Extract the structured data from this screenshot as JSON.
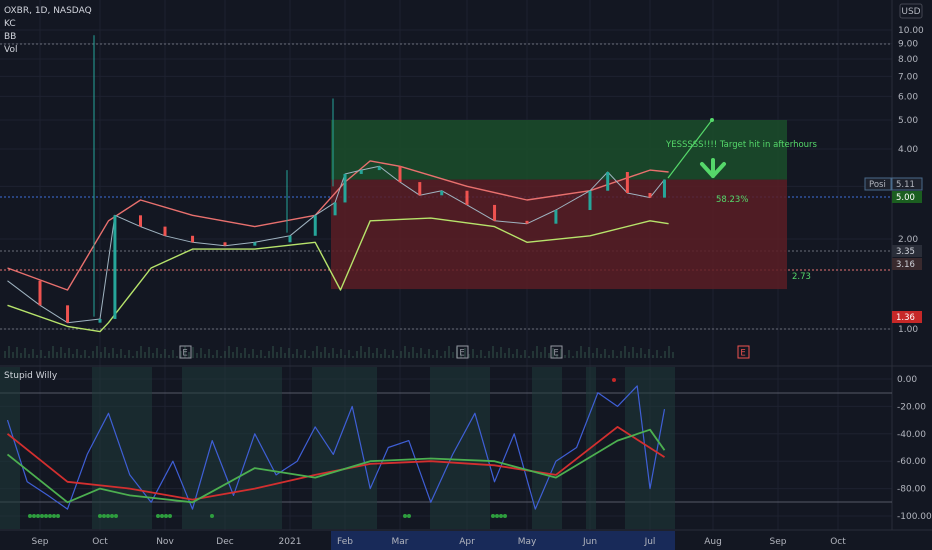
{
  "header": {
    "symbol_line": "OXBR, 1D, NASDAQ",
    "studies": [
      "KC",
      "BB",
      "Vol"
    ],
    "currency": "USD"
  },
  "colors": {
    "background": "#131722",
    "grid": "#1e2230",
    "up": "#26a69a",
    "down": "#ef5350",
    "profit_zone": "#1b4d2a",
    "loss_zone": "#5a1d24",
    "kc_upper": "#e8706e",
    "kc_lower": "#b7e36b",
    "osc_fast": "#3f5fd6",
    "osc_green": "#4caf50",
    "osc_red": "#d32f2f",
    "annotation": "#55d86a"
  },
  "chart_data": [
    {
      "type": "line",
      "title": "OXBR, 1D, NASDAQ",
      "subtitle": "",
      "ylabel": "",
      "xlabel": "",
      "ylim": [
        0.6,
        10.5
      ],
      "y_scale": "log",
      "grid": true,
      "x_ticks": [
        "Sep",
        "Oct",
        "Nov",
        "Dec",
        "2021",
        "Feb",
        "Mar",
        "Apr",
        "May",
        "Jun",
        "Jul",
        "Aug",
        "Sep",
        "Oct"
      ],
      "y_ticks": [
        "10.00",
        "9.00",
        "8.00",
        "7.00",
        "6.00",
        "5.00",
        "4.00",
        "3.00",
        "2.00",
        "1.00"
      ],
      "series": [
        {
          "role": "close",
          "x": [
            "Aug 15",
            "Sep 1",
            "Sep 15",
            "Oct 1",
            "Oct 8",
            "Oct 20",
            "Nov 1",
            "Nov 15",
            "Dec 1",
            "Dec 15",
            "Jan 1",
            "Jan 15",
            "Jan 26",
            "Feb 1",
            "Feb 10",
            "Feb 20",
            "Mar 1",
            "Mar 10",
            "Mar 20",
            "Apr 1",
            "Apr 15",
            "May 1",
            "May 15",
            "Jun 1",
            "Jun 10",
            "Jun 20",
            "Jul 1",
            "Jul 8"
          ],
          "values": [
            1.45,
            1.2,
            1.05,
            1.08,
            2.4,
            2.2,
            2.05,
            1.95,
            1.9,
            1.95,
            2.05,
            2.4,
            2.65,
            3.3,
            3.4,
            3.5,
            3.1,
            2.8,
            2.9,
            2.6,
            2.3,
            2.25,
            2.5,
            2.9,
            3.35,
            2.85,
            2.75,
            3.16
          ]
        },
        {
          "role": "kc_upper",
          "x": [
            "Aug 15",
            "Sep 15",
            "Oct 5",
            "Oct 20",
            "Nov 15",
            "Dec 15",
            "Jan 15",
            "Feb 1",
            "Feb 15",
            "Mar 1",
            "Apr 1",
            "May 1",
            "Jun 1",
            "Jul 1",
            "Jul 10"
          ],
          "values": [
            1.6,
            1.35,
            2.3,
            2.7,
            2.4,
            2.2,
            2.4,
            3.1,
            3.65,
            3.5,
            3.0,
            2.7,
            2.9,
            3.4,
            3.35
          ]
        },
        {
          "role": "kc_lower",
          "x": [
            "Aug 15",
            "Sep 15",
            "Oct 1",
            "Oct 5",
            "Oct 25",
            "Nov 15",
            "Dec 15",
            "Jan 15",
            "Jan 29",
            "Feb 15",
            "Mar 15",
            "Apr 15",
            "May 1",
            "Jun 1",
            "Jul 1",
            "Jul 10"
          ],
          "values": [
            1.2,
            1.02,
            0.98,
            1.05,
            1.6,
            1.85,
            1.85,
            1.95,
            1.35,
            2.3,
            2.35,
            2.2,
            1.95,
            2.05,
            2.3,
            2.25
          ]
        }
      ],
      "position": {
        "label": "Posi",
        "value": "5.11",
        "target_price": "5.00",
        "entry_price": "3.16",
        "stop_price": "1.36",
        "gain_label": "58.23%",
        "ratio_label": "2.73",
        "last_price": "3.35",
        "price_labels": [
          "5.11",
          "5.00",
          "3.35",
          "3.16",
          "1.36"
        ]
      },
      "earnings_markers": [
        "E",
        "E",
        "E",
        "E"
      ],
      "annotations": [
        "YESSSSS!!!! Target hit in afterhours"
      ]
    },
    {
      "type": "line",
      "title": "Stupid Willy",
      "subtitle": "",
      "xlabel": "",
      "ylabel": "",
      "ylim": [
        -105,
        5
      ],
      "grid": true,
      "y_ticks": [
        "0.00",
        "-20.00",
        "-40.00",
        "-60.00",
        "-80.00",
        "-100.00"
      ],
      "series": [
        {
          "role": "fast",
          "x": [
            "Aug 15",
            "Aug 25",
            "Sep 5",
            "Sep 15",
            "Sep 25",
            "Oct 5",
            "Oct 15",
            "Oct 25",
            "Nov 5",
            "Nov 15",
            "Nov 25",
            "Dec 5",
            "Dec 15",
            "Dec 25",
            "Jan 5",
            "Jan 15",
            "Jan 25",
            "Feb 5",
            "Feb 15",
            "Feb 25",
            "Mar 5",
            "Mar 15",
            "Mar 25",
            "Apr 5",
            "Apr 15",
            "Apr 25",
            "May 5",
            "May 15",
            "May 25",
            "Jun 5",
            "Jun 15",
            "Jun 25",
            "Jul 1",
            "Jul 8"
          ],
          "values": [
            -30,
            -75,
            -85,
            -95,
            -55,
            -25,
            -70,
            -90,
            -60,
            -95,
            -45,
            -85,
            -40,
            -70,
            -60,
            -35,
            -55,
            -20,
            -80,
            -50,
            -45,
            -90,
            -55,
            -25,
            -75,
            -40,
            -95,
            -60,
            -50,
            -10,
            -20,
            -5,
            -80,
            -22
          ]
        },
        {
          "role": "slow_red",
          "x": [
            "Aug 15",
            "Sep 15",
            "Oct 15",
            "Nov 15",
            "Dec 15",
            "Jan 15",
            "Feb 15",
            "Mar 15",
            "Apr 15",
            "May 15",
            "Jun 15",
            "Jul 8"
          ],
          "values": [
            -40,
            -75,
            -80,
            -88,
            -80,
            -70,
            -62,
            -60,
            -63,
            -70,
            -35,
            -57
          ]
        },
        {
          "role": "slow_green",
          "x": [
            "Aug 15",
            "Sep 15",
            "Oct 1",
            "Oct 15",
            "Nov 15",
            "Dec 15",
            "Jan 15",
            "Feb 15",
            "Mar 15",
            "Apr 15",
            "May 15",
            "Jun 15",
            "Jul 1",
            "Jul 8"
          ],
          "values": [
            -55,
            -90,
            -80,
            -85,
            -90,
            -65,
            -72,
            -60,
            -58,
            -60,
            -72,
            -45,
            -37,
            -52
          ]
        }
      ]
    }
  ]
}
